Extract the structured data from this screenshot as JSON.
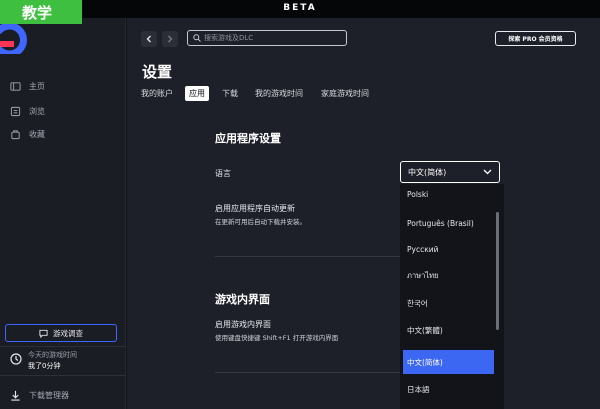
{
  "badge": {
    "text": "教学"
  },
  "topbar": {
    "beta": "BETA"
  },
  "sidebar": {
    "items": [
      {
        "label": "主页",
        "icon": "library-icon"
      },
      {
        "label": "浏览",
        "icon": "browse-icon"
      },
      {
        "label": "收藏",
        "icon": "wishlist-icon"
      }
    ],
    "survey_button": "游戏调查",
    "playtime": {
      "label": "今天的游戏时间",
      "value": "我了0分钟"
    },
    "downloads": "下载管理器"
  },
  "header": {
    "search_placeholder": "搜索游戏及DLC",
    "pro_button": "探索 PRO 会员资格"
  },
  "page": {
    "title": "设置",
    "tabs": [
      {
        "label": "我的账户",
        "active": false
      },
      {
        "label": "应用",
        "active": true
      },
      {
        "label": "下载",
        "active": false
      },
      {
        "label": "我的游戏时间",
        "active": false
      },
      {
        "label": "家庭游戏时间",
        "active": false
      }
    ]
  },
  "settings": {
    "app_section_title": "应用程序设置",
    "language_label": "语言",
    "language_value": "中文(简体)",
    "auto_update_label": "启用应用程序自动更新",
    "auto_update_desc": "在更新可用后自动下载并安装。",
    "overlay_section_title": "游戏内界面",
    "overlay_label": "启用游戏内界面",
    "overlay_desc": "使用键盘快捷键 Shift+F1 打开游戏内界面"
  },
  "dropdown": {
    "options": [
      "Polski",
      "Português (Brasil)",
      "Русский",
      "ภาษาไทย",
      "한국어",
      "中文(繁體)",
      "中文(简体)",
      "日本語"
    ],
    "selected": "中文(简体)"
  },
  "colors": {
    "accent": "#3c67f2",
    "badge_green": "#3fbf3f",
    "sidebar_bg": "#1b1d24",
    "main_bg": "#1e2029"
  }
}
